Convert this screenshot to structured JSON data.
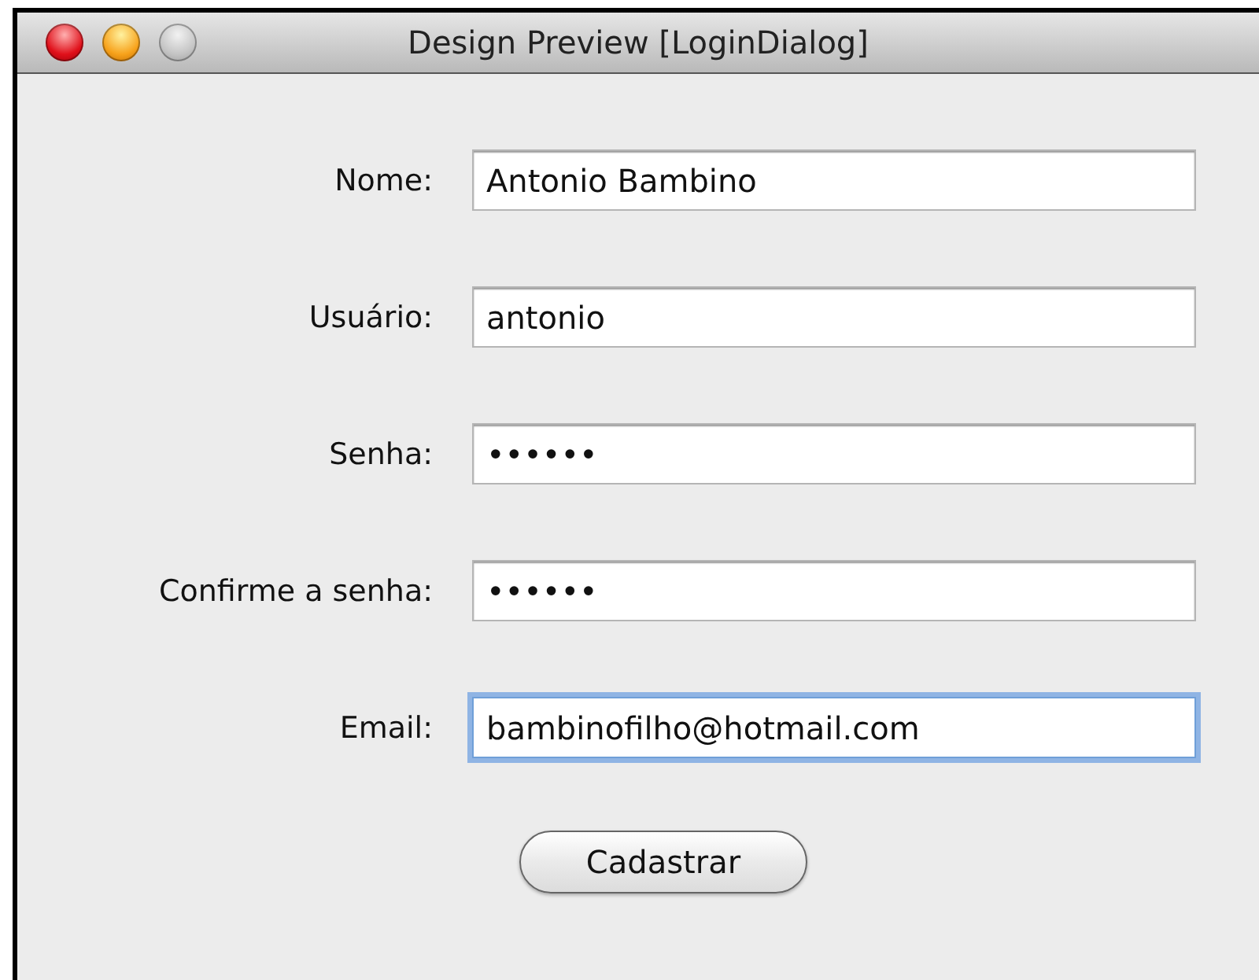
{
  "window": {
    "title": "Design Preview [LoginDialog]",
    "buttons": [
      {
        "kind": "close"
      },
      {
        "kind": "minimize"
      },
      {
        "kind": "zoom"
      }
    ]
  },
  "fields": [
    {
      "label": "Nome:",
      "value": "Antonio Bambino",
      "focused": false
    },
    {
      "label": "Usuário:",
      "value": "antonio",
      "focused": false
    },
    {
      "label": "Senha:",
      "value": "••••••",
      "focused": false
    },
    {
      "label": "Confirme a senha:",
      "value": "••••••",
      "focused": false
    },
    {
      "label": "Email:",
      "value": "bambinofilho@hotmail.com",
      "focused": true
    }
  ],
  "button": "Cadastrar"
}
